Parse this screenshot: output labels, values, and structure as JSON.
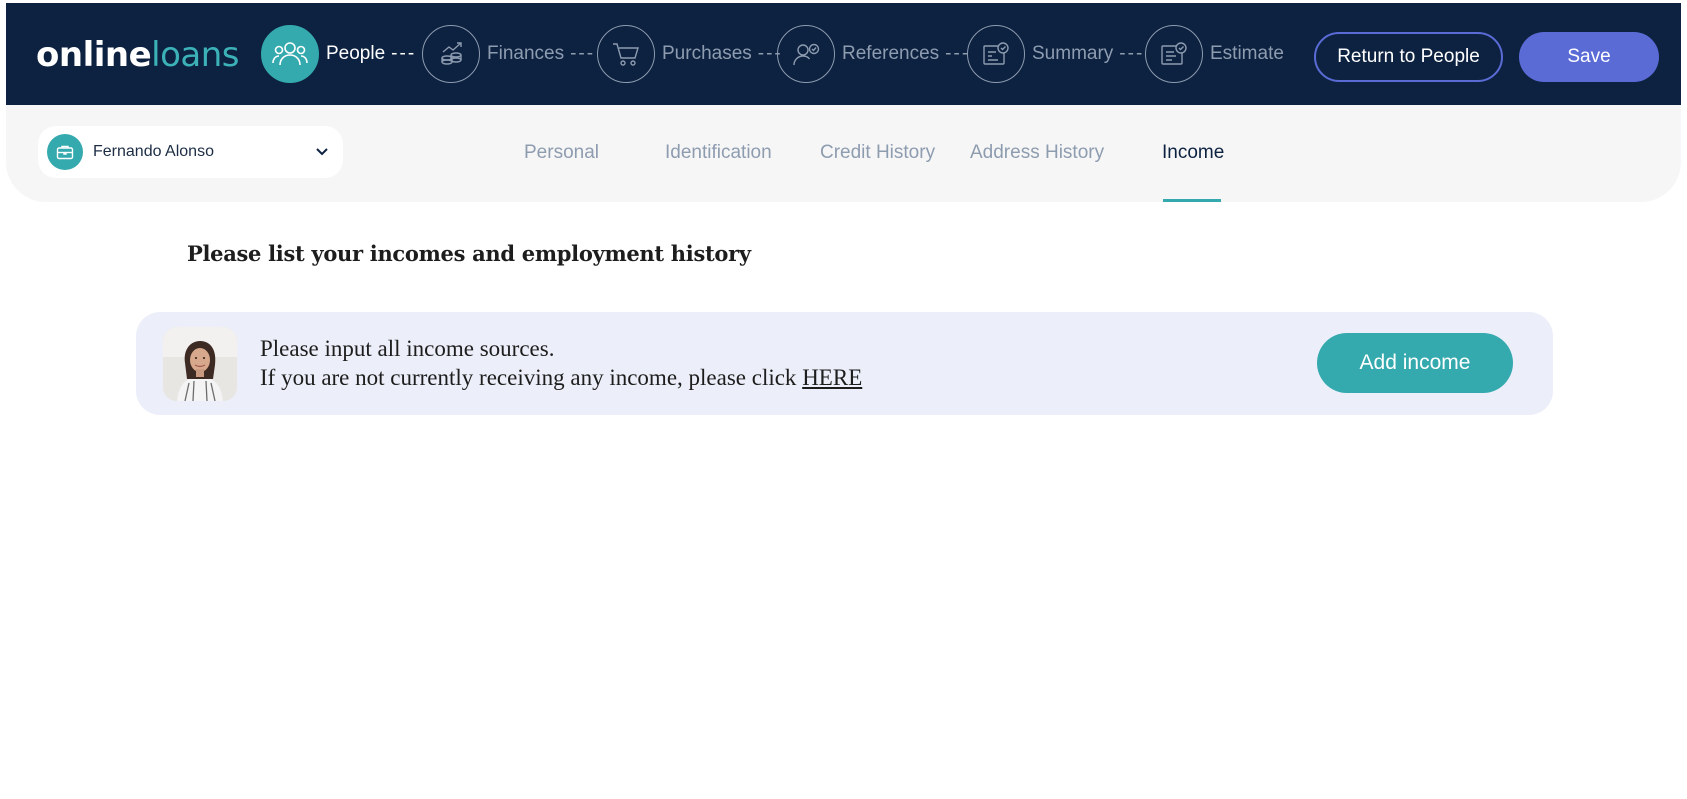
{
  "brand": {
    "logo_part1": "online",
    "logo_part2": "loans"
  },
  "steps": [
    {
      "label": "People",
      "icon": "people-icon",
      "active": true
    },
    {
      "label": "Finances",
      "icon": "finances-icon",
      "active": false
    },
    {
      "label": "Purchases",
      "icon": "cart-icon",
      "active": false
    },
    {
      "label": "References",
      "icon": "references-icon",
      "active": false
    },
    {
      "label": "Summary",
      "icon": "summary-icon",
      "active": false
    },
    {
      "label": "Estimate",
      "icon": "estimate-icon",
      "active": false
    }
  ],
  "step_separator": "---",
  "header": {
    "return_label": "Return to People",
    "save_label": "Save"
  },
  "person_selector": {
    "selected": "Fernando Alonso",
    "icon": "briefcase-icon"
  },
  "tabs": [
    {
      "label": "Personal",
      "active": false
    },
    {
      "label": "Identification",
      "active": false
    },
    {
      "label": "Credit History",
      "active": false
    },
    {
      "label": "Address History",
      "active": false
    },
    {
      "label": "Income",
      "active": true
    }
  ],
  "main": {
    "heading": "Please list your incomes and employment history",
    "info_line1": "Please input all income sources.",
    "info_line2_prefix": "If you are not currently receiving any income, please click",
    "info_link": "HERE",
    "add_income_label": "Add income"
  },
  "colors": {
    "navy": "#0d2240",
    "teal": "#34a9ae",
    "indigo": "#5a6bd6",
    "card_bg": "#eceff9",
    "muted": "#8e9cb0"
  }
}
